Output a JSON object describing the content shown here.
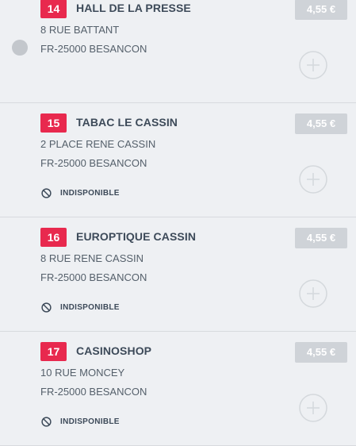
{
  "items": [
    {
      "number": "14",
      "name": "HALL DE LA PRESSE",
      "address_line1": "8 RUE BATTANT",
      "address_line2": "FR-25000 BESANCON",
      "status": "",
      "price": "4,55 €",
      "status_icon": "ban-icon",
      "selected_indicator": "radio-dot"
    },
    {
      "number": "15",
      "name": "TABAC LE CASSIN",
      "address_line1": "2 PLACE RENE CASSIN",
      "address_line2": "FR-25000 BESANCON",
      "status": "INDISPONIBLE",
      "price": "4,55 €",
      "status_icon": "ban-icon"
    },
    {
      "number": "16",
      "name": "EUROPTIQUE CASSIN",
      "address_line1": "8 RUE RENE CASSIN",
      "address_line2": "FR-25000 BESANCON",
      "status": "INDISPONIBLE",
      "price": "4,55 €",
      "status_icon": "ban-icon"
    },
    {
      "number": "17",
      "name": "CASINOSHOP",
      "address_line1": "10 RUE MONCEY",
      "address_line2": "FR-25000 BESANCON",
      "status": "INDISPONIBLE",
      "price": "4,55 €",
      "status_icon": "ban-icon"
    }
  ],
  "colors": {
    "number_badge": "#e8294e",
    "price_badge": "#cfd3d8",
    "title_text": "#3d4a59",
    "background": "#eef0f3"
  }
}
